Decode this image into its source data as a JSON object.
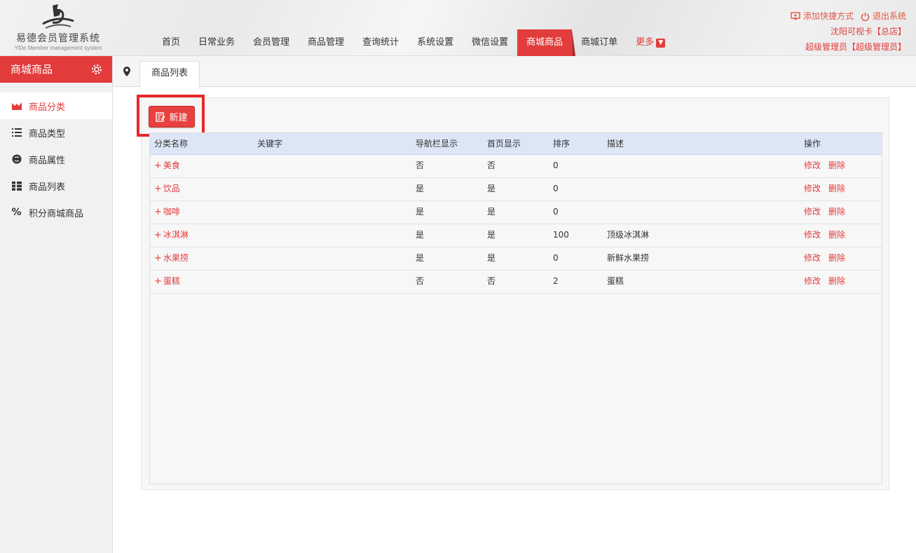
{
  "header": {
    "brand": "易德会员管理系统",
    "brand_en": "YiDe Member management system",
    "nav": [
      {
        "label": "首页"
      },
      {
        "label": "日常业务"
      },
      {
        "label": "会员管理"
      },
      {
        "label": "商品管理"
      },
      {
        "label": "查询统计"
      },
      {
        "label": "系统设置"
      },
      {
        "label": "微信设置"
      },
      {
        "label": "商城商品",
        "active": true
      },
      {
        "label": "商城订单"
      }
    ],
    "more_label": "更多",
    "shortcut_label": "添加快捷方式",
    "logout_label": "退出系统",
    "store_label": "沈阳可视卡【总店】",
    "user_label": "超级管理员【超级管理员】"
  },
  "sidebar": {
    "title": "商城商品",
    "items": [
      {
        "label": "商品分类",
        "icon": "chart-icon",
        "active": true
      },
      {
        "label": "商品类型",
        "icon": "list-icon"
      },
      {
        "label": "商品属性",
        "icon": "coin-icon"
      },
      {
        "label": "商品列表",
        "icon": "grid-icon"
      },
      {
        "label": "积分商城商品",
        "icon": "percent-icon"
      }
    ]
  },
  "tabs": {
    "active_label": "商品列表"
  },
  "toolbar": {
    "new_label": "新建"
  },
  "table": {
    "columns": [
      "分类名称",
      "关键字",
      "导航栏显示",
      "首页显示",
      "排序",
      "描述",
      "操作"
    ],
    "rows": [
      {
        "name": "美食",
        "keyword": "",
        "nav": "否",
        "home": "否",
        "sort": "0",
        "desc": ""
      },
      {
        "name": "饮品",
        "keyword": "",
        "nav": "是",
        "home": "是",
        "sort": "0",
        "desc": ""
      },
      {
        "name": "咖啡",
        "keyword": "",
        "nav": "是",
        "home": "是",
        "sort": "0",
        "desc": ""
      },
      {
        "name": "冰淇淋",
        "keyword": "",
        "nav": "是",
        "home": "是",
        "sort": "100",
        "desc": "顶级冰淇淋"
      },
      {
        "name": "水果捞",
        "keyword": "",
        "nav": "是",
        "home": "是",
        "sort": "0",
        "desc": "新鲜水果捞"
      },
      {
        "name": "蛋糕",
        "keyword": "",
        "nav": "否",
        "home": "否",
        "sort": "2",
        "desc": "蛋糕"
      }
    ],
    "edit_label": "修改",
    "delete_label": "删除",
    "expand_symbol": "+"
  },
  "colors": {
    "accent": "#e23c3c",
    "header_row": "#dce6f5",
    "highlight_box": "#e8282b"
  }
}
